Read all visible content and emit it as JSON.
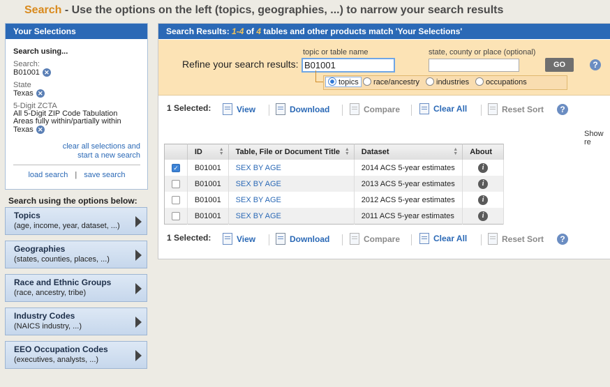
{
  "header": {
    "accent": "Search",
    "instruction": " - Use the options on the left (topics, geographies, ...) to narrow your search results"
  },
  "selections": {
    "title": "Your Selections",
    "using_label": "Search using...",
    "criteria": [
      {
        "label": "Search:",
        "value": "B01001"
      },
      {
        "label": "State",
        "value": "Texas"
      },
      {
        "label": "5-Digit ZCTA",
        "value": "All 5-Digit ZIP Code Tabulation Areas fully within/partially within Texas"
      }
    ],
    "clear_line1": "clear all selections and",
    "clear_line2": "start a new search",
    "load_label": "load search",
    "save_label": "save search",
    "separator": "|"
  },
  "options": {
    "heading": "Search using the options below:",
    "items": [
      {
        "title": "Topics",
        "subtitle": "(age, income, year, dataset, ...)"
      },
      {
        "title": "Geographies",
        "subtitle": "(states, counties, places, ...)"
      },
      {
        "title": "Race and Ethnic Groups",
        "subtitle": "(race, ancestry, tribe)"
      },
      {
        "title": "Industry Codes",
        "subtitle": "(NAICS industry, ...)"
      },
      {
        "title": "EEO Occupation Codes",
        "subtitle": "(executives, analysts, ...)"
      }
    ]
  },
  "results": {
    "head_prefix": "Search Results: ",
    "head_range": "1-4",
    "head_of": " of ",
    "head_total": "4",
    "head_suffix": " tables and other products match 'Your Selections'",
    "refine_label": "Refine your search results:",
    "topic_label": "topic or table name",
    "topic_value": "B01001",
    "geo_label": "state, county or place (optional)",
    "geo_value": "",
    "go_label": "GO",
    "help": "?",
    "radios": [
      {
        "label": "topics",
        "selected": true
      },
      {
        "label": "race/ancestry",
        "selected": false
      },
      {
        "label": "industries",
        "selected": false
      },
      {
        "label": "occupations",
        "selected": false
      }
    ],
    "toolbar": {
      "selected": "1 Selected:",
      "view": "View",
      "download": "Download",
      "compare": "Compare",
      "clear_all": "Clear All",
      "reset_sort": "Reset Sort"
    },
    "show_label": "Show re",
    "table": {
      "columns": [
        "ID",
        "Table, File or Document Title",
        "Dataset",
        "About"
      ],
      "rows": [
        {
          "checked": true,
          "id": "B01001",
          "title": "SEX BY AGE",
          "dataset": "2014 ACS 5-year estimates"
        },
        {
          "checked": false,
          "id": "B01001",
          "title": "SEX BY AGE",
          "dataset": "2013 ACS 5-year estimates"
        },
        {
          "checked": false,
          "id": "B01001",
          "title": "SEX BY AGE",
          "dataset": "2012 ACS 5-year estimates"
        },
        {
          "checked": false,
          "id": "B01001",
          "title": "SEX BY AGE",
          "dataset": "2011 ACS 5-year estimates"
        }
      ]
    }
  },
  "colors": {
    "header_blue": "#2b69b6",
    "accent_orange": "#d98a1d",
    "refine_bg": "#fce3b5",
    "link_blue": "#2b69b6"
  }
}
